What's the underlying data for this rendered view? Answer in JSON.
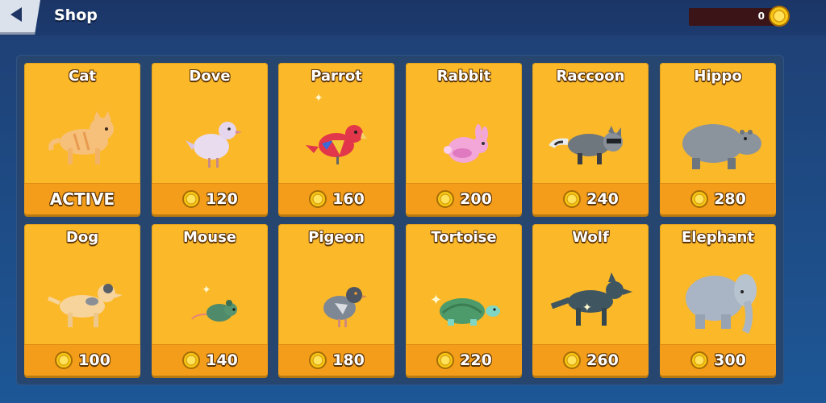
{
  "header": {
    "title": "Shop",
    "coins": "0"
  },
  "colors": {
    "card": "#fbb828",
    "card_footer": "#f39d1b",
    "background": "#1e4c86",
    "panel": "#26466f"
  },
  "animals": [
    {
      "name": "Cat",
      "status": "ACTIVE",
      "price": null,
      "icon": "cat-icon"
    },
    {
      "name": "Dove",
      "price": "120",
      "icon": "dove-icon"
    },
    {
      "name": "Parrot",
      "price": "160",
      "icon": "parrot-icon"
    },
    {
      "name": "Rabbit",
      "price": "200",
      "icon": "rabbit-icon"
    },
    {
      "name": "Raccoon",
      "price": "240",
      "icon": "raccoon-icon"
    },
    {
      "name": "Hippo",
      "price": "280",
      "icon": "hippo-icon"
    },
    {
      "name": "Dog",
      "price": "100",
      "icon": "dog-icon"
    },
    {
      "name": "Mouse",
      "price": "140",
      "icon": "mouse-icon"
    },
    {
      "name": "Pigeon",
      "price": "180",
      "icon": "pigeon-icon"
    },
    {
      "name": "Tortoise",
      "price": "220",
      "icon": "tortoise-icon"
    },
    {
      "name": "Wolf",
      "price": "260",
      "icon": "wolf-icon"
    },
    {
      "name": "Elephant",
      "price": "300",
      "icon": "elephant-icon"
    }
  ]
}
